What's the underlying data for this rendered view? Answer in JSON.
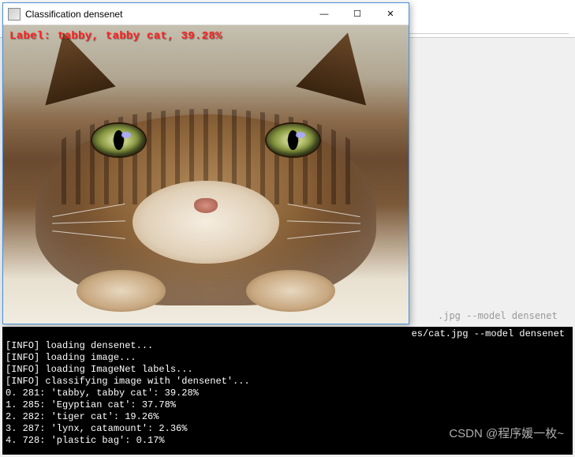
{
  "window": {
    "title": "Classification densenet",
    "min_glyph": "—",
    "max_glyph": "☐",
    "close_glyph": "✕"
  },
  "overlay": {
    "label": "Label: tabby, tabby cat, 39.28%"
  },
  "bg": {
    "cmd_fragment": ".jpg --model densenet"
  },
  "terminal": {
    "cmd_tail": "es/cat.jpg --model densenet",
    "lines": [
      "[INFO] loading densenet...",
      "[INFO] loading image...",
      "[INFO] loading ImageNet labels...",
      "[INFO] classifying image with 'densenet'...",
      "0. 281: 'tabby, tabby cat': 39.28%",
      "1. 285: 'Egyptian cat': 37.78%",
      "2. 282: 'tiger cat': 19.26%",
      "3. 287: 'lynx, catamount': 2.36%",
      "4. 728: 'plastic bag': 0.17%"
    ]
  },
  "watermark": "CSDN @程序媛一枚~"
}
